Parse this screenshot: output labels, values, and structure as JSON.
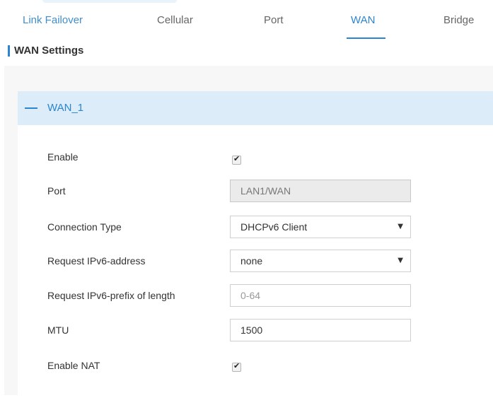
{
  "tabs": [
    {
      "label": "Link Failover"
    },
    {
      "label": "Cellular"
    },
    {
      "label": "Port"
    },
    {
      "label": "WAN"
    },
    {
      "label": "Bridge"
    }
  ],
  "section_title": "WAN Settings",
  "card": {
    "title": "WAN_1"
  },
  "form": {
    "enable": {
      "label": "Enable",
      "checked": true
    },
    "port": {
      "label": "Port",
      "value": "LAN1/WAN"
    },
    "connection_type": {
      "label": "Connection Type",
      "value": "DHCPv6 Client"
    },
    "request_ipv6_address": {
      "label": "Request IPv6-address",
      "value": "none"
    },
    "request_ipv6_prefix": {
      "label": "Request IPv6-prefix of length",
      "placeholder": "0-64"
    },
    "mtu": {
      "label": "MTU",
      "value": "1500"
    },
    "enable_nat": {
      "label": "Enable NAT",
      "checked": true
    }
  },
  "colors": {
    "accent": "#2b85d0",
    "header_bg": "#dcedf9",
    "panel_bg": "#f7f7f7"
  },
  "icons": {
    "check": "check-icon",
    "dropdown": "caret-down-icon",
    "collapse": "minus-icon"
  }
}
